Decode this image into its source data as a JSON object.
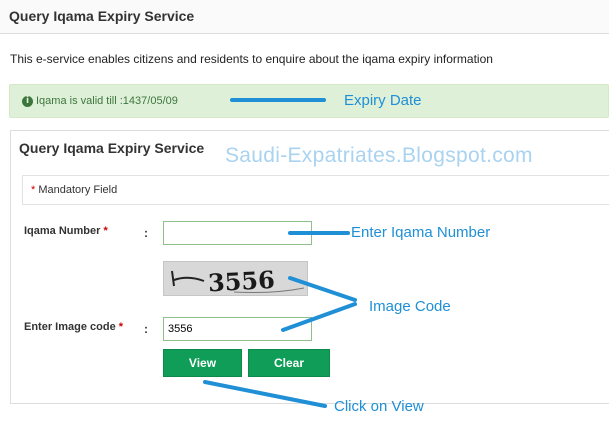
{
  "header": {
    "title": "Query Iqama Expiry Service"
  },
  "intro": "This e-service enables citizens and residents to enquire about the iqama expiry information",
  "alert": {
    "icon": "info-icon",
    "text": "Iqama is valid till :1437/05/09"
  },
  "panel": {
    "title": "Query Iqama Expiry Service",
    "mandatory_star": "*",
    "mandatory_label": "Mandatory Field",
    "iqama_label": "Iqama Number",
    "image_code_label": "Enter Image code",
    "required_star": "*",
    "colon": ":",
    "iqama_value": "",
    "captcha_text": "3556",
    "image_code_value": "3556",
    "view_label": "View",
    "clear_label": "Clear"
  },
  "watermark": "Saudi-Expatriates.Blogspot.com",
  "annotations": {
    "expiry_date": "Expiry Date",
    "enter_iqama": "Enter Iqama Number",
    "image_code": "Image Code",
    "click_view": "Click on View"
  },
  "colors": {
    "button_green": "#0f9d58",
    "alert_bg": "#dff0d8",
    "alert_text": "#3c763d",
    "annotation_blue": "#1f8fd6"
  }
}
